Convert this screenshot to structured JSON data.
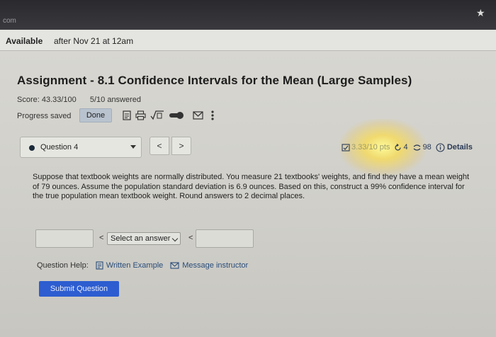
{
  "browser": {
    "url_text": "com"
  },
  "availability": {
    "label": "Available",
    "value": "after Nov 21 at 12am"
  },
  "assignment": {
    "title": "Assignment - 8.1 Confidence Intervals for the Mean (Large Samples)",
    "score": "Score: 43.33/100",
    "answered": "5/10 answered",
    "progress": "Progress saved",
    "done_label": "Done"
  },
  "toolbar_icons": [
    "document-icon",
    "print-icon",
    "sqrt-icon",
    "toggle-icon",
    "mail-icon",
    "more-vertical-icon"
  ],
  "question_nav": {
    "selected": "Question 4",
    "prev": "<",
    "next": ">"
  },
  "status": {
    "points": "3.33/10 pts",
    "retries": "4",
    "attempts": "98",
    "details": "Details"
  },
  "question": {
    "text": "Suppose that textbook weights are normally distributed. You measure 21 textbooks' weights, and find they have a mean weight of 79 ounces. Assume the population standard deviation is 6.9 ounces. Based on this, construct a 99% confidence interval for the true population mean textbook weight. Round answers to 2 decimal places.",
    "lt_symbol": "<",
    "select_placeholder": "Select an answer",
    "lower_value": "",
    "upper_value": ""
  },
  "help": {
    "label": "Question Help:",
    "written_example": "Written Example",
    "message_instructor": "Message instructor"
  },
  "submit_label": "Submit Question",
  "colors": {
    "accent": "#2d5dd0",
    "link": "#2a4d7a",
    "glare": "#f5d86a"
  }
}
